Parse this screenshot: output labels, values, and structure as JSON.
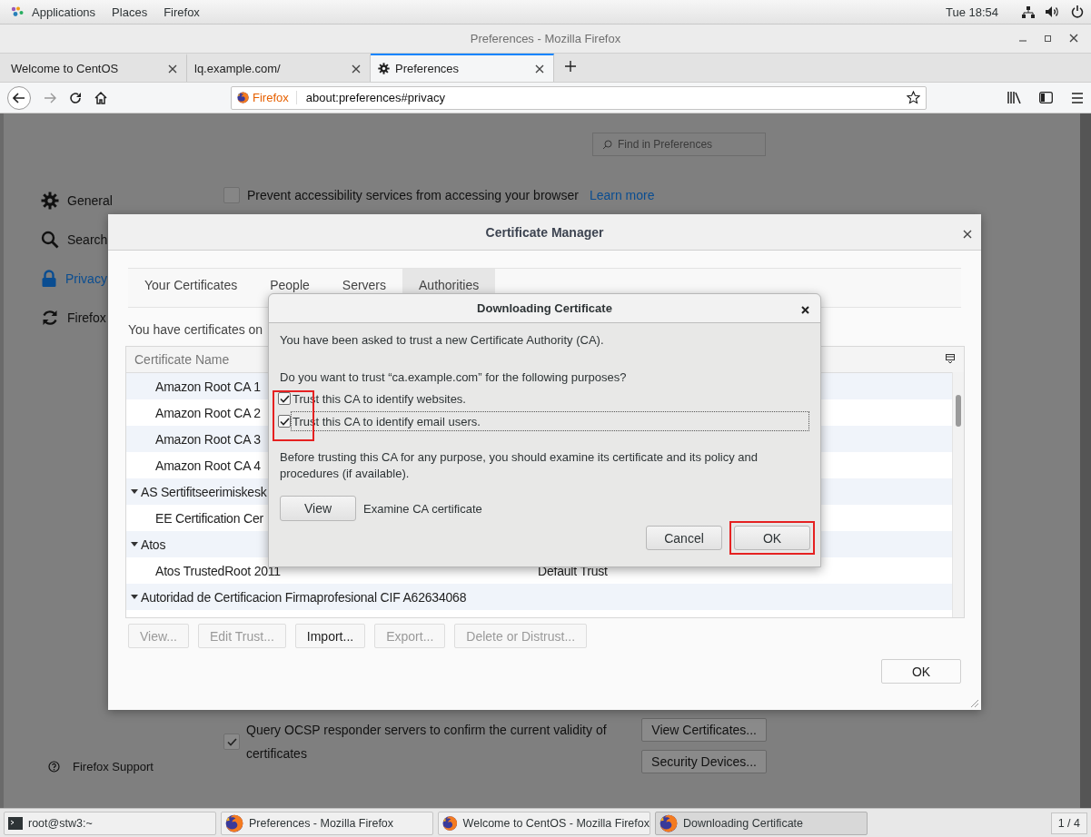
{
  "top_bar": {
    "menus": [
      "Applications",
      "Places",
      "Firefox"
    ],
    "clock": "Tue 18:54"
  },
  "window": {
    "title": "Preferences - Mozilla Firefox"
  },
  "tabs": [
    {
      "label": "Welcome to CentOS",
      "selected": false
    },
    {
      "label": "lq.example.com/",
      "selected": false
    },
    {
      "label": "Preferences",
      "selected": true
    }
  ],
  "address_bar": {
    "identity": "Firefox",
    "url": "about:preferences#privacy"
  },
  "preferences": {
    "search": {
      "placeholder": "Find in Preferences"
    },
    "sidebar": [
      {
        "label": "General",
        "selected": false
      },
      {
        "label": "Search",
        "selected": false
      },
      {
        "label": "Privacy",
        "selected": true
      },
      {
        "label": "Firefox",
        "selected": false
      }
    ],
    "support": "Firefox Support",
    "accessibility": {
      "label": "Prevent accessibility services from accessing your browser",
      "checked": false,
      "link": "Learn more"
    },
    "ocsp": {
      "label": "Query OCSP responder servers to confirm the current validity of certificates",
      "checked": true
    },
    "buttons": [
      "View Certificates...",
      "Security Devices..."
    ]
  },
  "certificate_manager": {
    "title": "Certificate Manager",
    "tabs": [
      {
        "label": "Your Certificates",
        "selected": false
      },
      {
        "label": "People",
        "selected": false
      },
      {
        "label": "Servers",
        "selected": false
      },
      {
        "label": "Authorities",
        "selected": true
      }
    ],
    "intro": "You have certificates on",
    "columns": [
      "Certificate Name"
    ],
    "rows": [
      {
        "kind": "cert",
        "name": "Amazon Root CA 1"
      },
      {
        "kind": "cert",
        "name": "Amazon Root CA 2"
      },
      {
        "kind": "cert",
        "name": "Amazon Root CA 3"
      },
      {
        "kind": "cert",
        "name": "Amazon Root CA 4"
      },
      {
        "kind": "group",
        "name": "AS Sertifitseerimiskesk",
        "expanded": true,
        "children": [
          {
            "kind": "cert",
            "name": "EE Certification Cer"
          }
        ]
      },
      {
        "kind": "group",
        "name": "Atos",
        "expanded": true,
        "children": [
          {
            "kind": "cert",
            "name": "Atos TrustedRoot 2011",
            "token": "Default Trust"
          }
        ]
      },
      {
        "kind": "group",
        "name": "Autoridad de Certificacion Firmaprofesional CIF A62634068",
        "expanded": true
      }
    ],
    "buttons": [
      {
        "label": "View...",
        "disabled": true
      },
      {
        "label": "Edit Trust...",
        "disabled": true
      },
      {
        "label": "Import...",
        "disabled": false
      },
      {
        "label": "Export...",
        "disabled": true
      },
      {
        "label": "Delete or Distrust...",
        "disabled": true
      }
    ],
    "ok": "OK"
  },
  "download_dialog": {
    "title": "Downloading Certificate",
    "message": "You have been asked to trust a new Certificate Authority (CA).",
    "question": "Do you want to trust “ca.example.com” for the following purposes?",
    "options": [
      {
        "label": "Trust this CA to identify websites.",
        "checked": true,
        "focused": false
      },
      {
        "label": "Trust this CA to identify email users.",
        "checked": true,
        "focused": true
      }
    ],
    "options_highlighted": true,
    "advice": "Before trusting this CA for any purpose, you should examine its certificate and its policy and procedures (if available).",
    "view_button": "View",
    "view_hint": "Examine CA certificate",
    "buttons": [
      {
        "label": "Cancel",
        "highlighted": false
      },
      {
        "label": "OK",
        "highlighted": true
      }
    ]
  },
  "taskbar": {
    "items": [
      {
        "kind": "terminal",
        "label": "root@stw3:~",
        "selected": false
      },
      {
        "kind": "browser",
        "label": "Preferences - Mozilla Firefox",
        "selected": false
      },
      {
        "kind": "browser",
        "label": "Welcome to CentOS - Mozilla Firefox",
        "selected": false
      },
      {
        "kind": "browser",
        "label": "Downloading Certificate",
        "selected": true
      }
    ],
    "workspace": "1 / 4"
  }
}
